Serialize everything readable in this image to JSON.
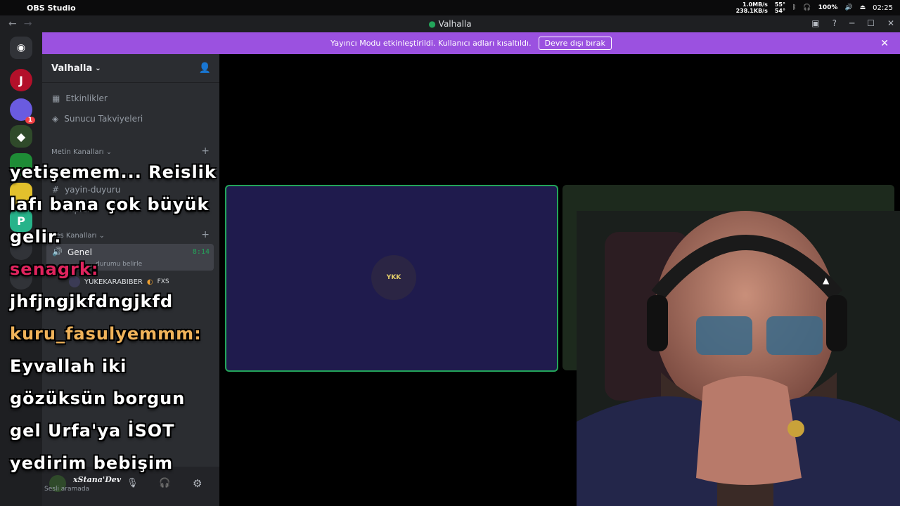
{
  "menubar": {
    "app_name": "OBS Studio",
    "net_up": "1.0MB/s",
    "net_down": "238.1KB/s",
    "temp_hi": "55°",
    "temp_lo": "54°",
    "battery": "100%",
    "clock": "02:25"
  },
  "window": {
    "title": "Valhalla"
  },
  "guilds": {
    "badge_count": "1"
  },
  "banner": {
    "message": "Yayıncı Modu etkinleştirildi. Kullanıcı adları kısaltıldı.",
    "disable_label": "Devre dışı bırak"
  },
  "sidebar": {
    "server_name": "Valhalla",
    "events": "Etkinlikler",
    "boosts": "Sunucu Takviyeleri",
    "text_category": "Metin Kanalları",
    "channels": [
      "yayin-duyuru",
      "klipler"
    ],
    "voice_category": "Ses Kanalları",
    "voice_channel": "Genel",
    "voice_timer": "8:14",
    "status_hint": "durumu belirle",
    "voice_member": "YUKEKARABIBER",
    "voice_member_tag": "FXS"
  },
  "user": {
    "name": "xStana'Dev",
    "status": "Sesli aramada"
  },
  "stage": {
    "tile_avatar_text": "YKK"
  },
  "overlay": {
    "lines": [
      {
        "text": "yetişemem... Reislik",
        "kind": "msg"
      },
      {
        "text": "lafı bana çok büyük",
        "kind": "msg"
      },
      {
        "text": "gelir.",
        "kind": "msg"
      },
      {
        "text": "senagrk:",
        "kind": "user1"
      },
      {
        "text": "jhfjngjkfdngjkfd",
        "kind": "msg"
      },
      {
        "text": "kuru_fasulyemmm:",
        "kind": "user2"
      },
      {
        "text": "Eyvallah iki",
        "kind": "msg"
      },
      {
        "text": "gözüksün borgun",
        "kind": "msg"
      },
      {
        "text": "gel Urfa'ya İSOT",
        "kind": "msg"
      },
      {
        "text": "yedirim bebişim",
        "kind": "msg"
      }
    ]
  },
  "colors": {
    "banner": "#9b51e0",
    "speaking_border": "#23a55a",
    "tile_bg": "#1f1b4d"
  }
}
